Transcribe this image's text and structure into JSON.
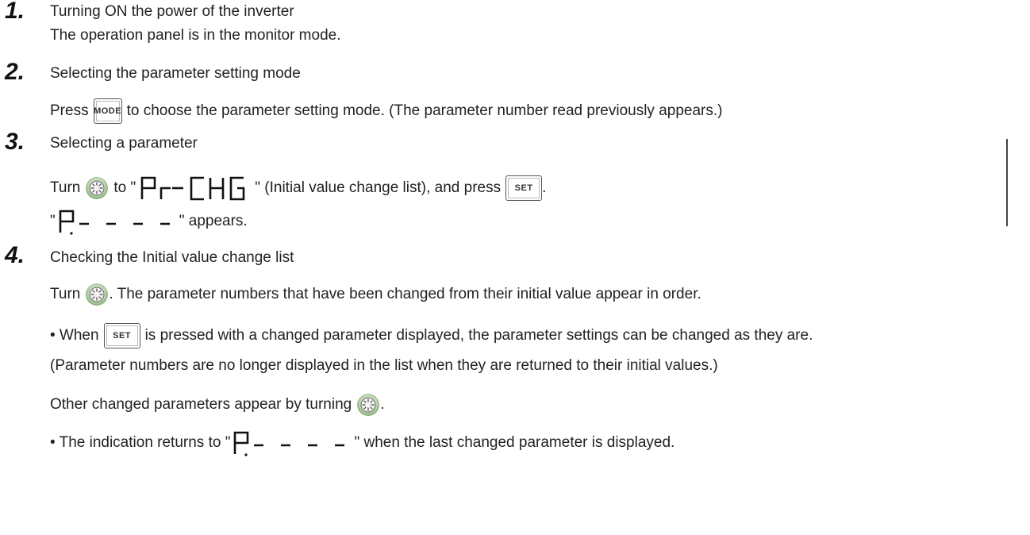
{
  "steps": [
    {
      "num": "1.",
      "title": "Turning ON the power of the inverter",
      "desc": "The operation panel is in the monitor mode."
    },
    {
      "num": "2.",
      "title": "Selecting the parameter setting mode",
      "line_pre": "Press",
      "key": "MODE",
      "line_post": "to choose the parameter setting mode. (The parameter number read previously appears.)"
    },
    {
      "num": "3.",
      "title": "Selecting a parameter",
      "line1_pre": "Turn",
      "line1_mid": "to \"",
      "line1_post": "\" (Initial value change list), and press",
      "key": "SET",
      "line1_end": ".",
      "line2_pre": "\"",
      "line2_post": "\" appears."
    },
    {
      "num": "4.",
      "title": "Checking the Initial value change list",
      "line1_pre": "Turn",
      "line1_post": ". The parameter numbers that have been changed from their initial value appear in order.",
      "bullet1_pre": "• When",
      "key": "SET",
      "bullet1_post": "is pressed with a changed parameter displayed, the parameter settings can be changed as they are.",
      "note": "(Parameter numbers are no longer displayed in the list when they are returned to their initial values.)",
      "other_pre": "Other changed parameters appear by turning",
      "other_post": ".",
      "bullet2_pre": "• The indication returns to \"",
      "bullet2_post": "\" when the last changed parameter is displayed."
    }
  ],
  "icons": {
    "dial": "setting-dial-icon",
    "display": "seven-segment-display"
  },
  "display_text": {
    "pr_chg": "Pr-CHG",
    "p_dashes": "P.----"
  }
}
